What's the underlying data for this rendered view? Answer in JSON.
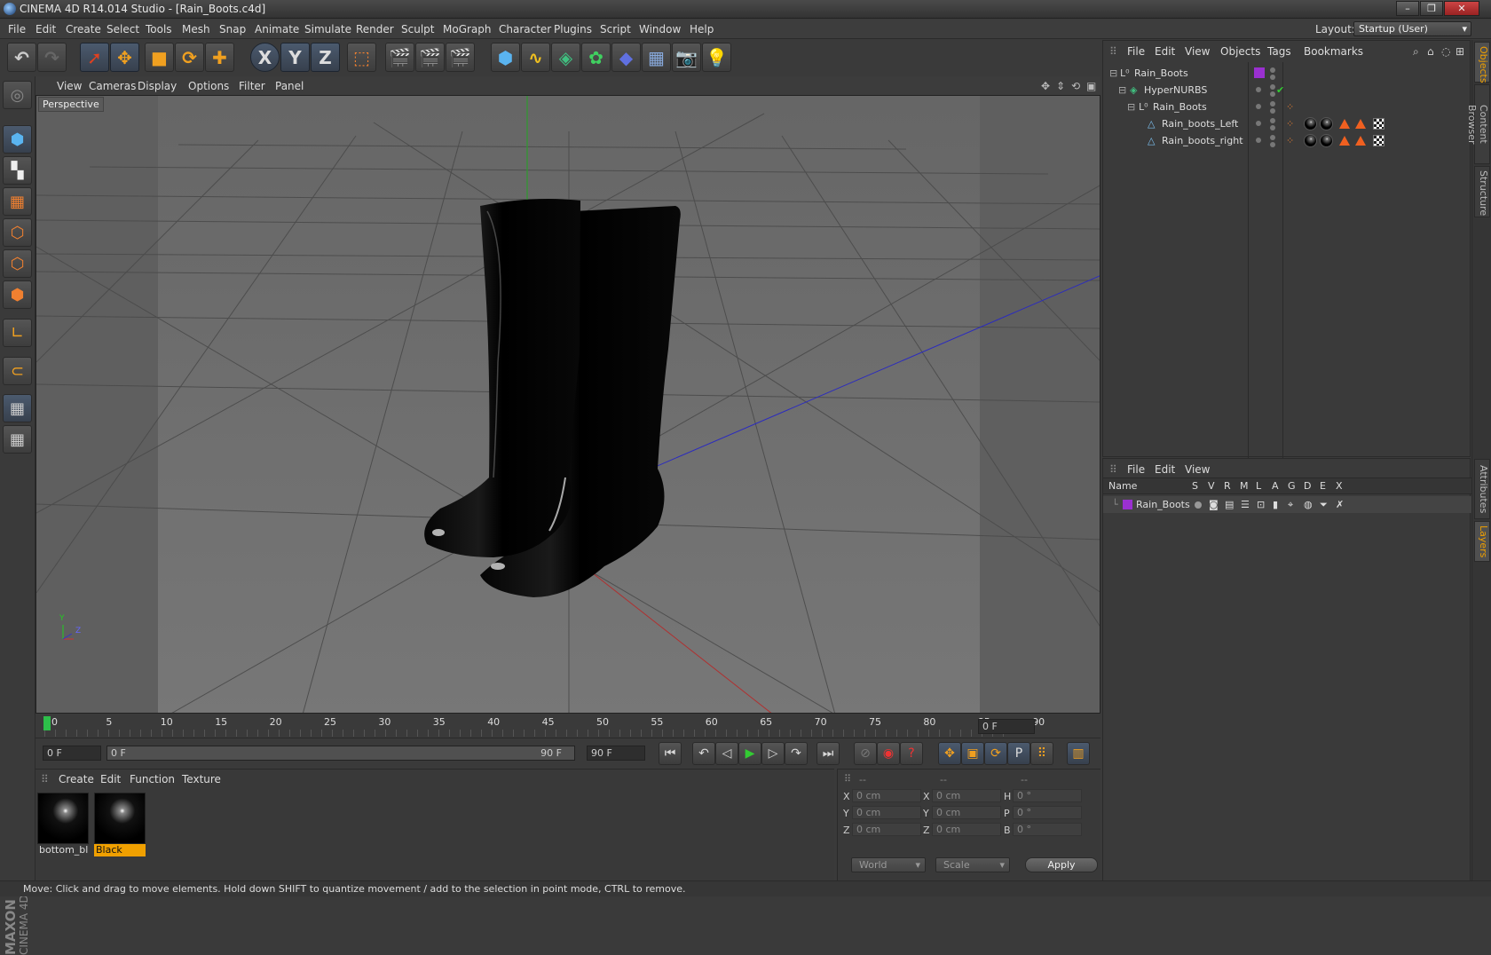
{
  "window": {
    "title": "CINEMA 4D R14.014 Studio - [Rain_Boots.c4d]"
  },
  "menu": [
    "File",
    "Edit",
    "Create",
    "Select",
    "Tools",
    "Mesh",
    "Snap",
    "Animate",
    "Simulate",
    "Render",
    "Sculpt",
    "MoGraph",
    "Character",
    "Plugins",
    "Script",
    "Window",
    "Help"
  ],
  "layout": {
    "label": "Layout:",
    "value": "Startup (User)"
  },
  "toolbar": {
    "x": "X",
    "y": "Y",
    "z": "Z",
    "p": "P"
  },
  "viewport": {
    "menu": [
      "View",
      "Cameras",
      "Display",
      "Options",
      "Filter",
      "Panel"
    ],
    "camera": "Perspective"
  },
  "timeline": {
    "ticks": [
      "0",
      "5",
      "10",
      "15",
      "20",
      "25",
      "30",
      "35",
      "40",
      "45",
      "50",
      "55",
      "60",
      "65",
      "70",
      "75",
      "80",
      "85",
      "90"
    ],
    "current": "0 F",
    "start": "0 F",
    "range_start": "0 F",
    "range_end": "90 F",
    "end": "90 F"
  },
  "materials": {
    "menu": [
      "Create",
      "Edit",
      "Function",
      "Texture"
    ],
    "items": [
      {
        "name": "bottom_bla"
      },
      {
        "name": "Black"
      }
    ]
  },
  "coords": {
    "header": [
      "--",
      "--",
      "--"
    ],
    "rows": [
      {
        "a": "X",
        "av": "0 cm",
        "b": "X",
        "bv": "0 cm",
        "c": "H",
        "cv": "0 °"
      },
      {
        "a": "Y",
        "av": "0 cm",
        "b": "Y",
        "bv": "0 cm",
        "c": "P",
        "cv": "0 °"
      },
      {
        "a": "Z",
        "av": "0 cm",
        "b": "Z",
        "bv": "0 cm",
        "c": "B",
        "cv": "0 °"
      }
    ],
    "world": "World",
    "scale": "Scale",
    "apply": "Apply"
  },
  "objects": {
    "menu": [
      "File",
      "Edit",
      "View",
      "Objects",
      "Tags",
      "Bookmarks"
    ],
    "tree": [
      {
        "name": "Rain_Boots"
      },
      {
        "name": "HyperNURBS"
      },
      {
        "name": "Rain_Boots"
      },
      {
        "name": "Rain_boots_Left"
      },
      {
        "name": "Rain_boots_right"
      }
    ]
  },
  "layers": {
    "menu": [
      "File",
      "Edit",
      "View"
    ],
    "columns": [
      "Name",
      "S",
      "V",
      "R",
      "M",
      "L",
      "A",
      "G",
      "D",
      "E",
      "X"
    ],
    "rows": [
      {
        "name": "Rain_Boots",
        "color": "#9a30d0"
      }
    ]
  },
  "sidetabs": [
    "Objects",
    "Content Browser",
    "Structure",
    "Attributes",
    "Layers"
  ],
  "status": "Move: Click and drag to move elements. Hold down SHIFT to quantize movement / add to the selection in point mode, CTRL to remove.",
  "brand": {
    "maxon": "MAXON",
    "cinema": "CINEMA 4D"
  },
  "axes": {
    "y": "Y",
    "z": "Z"
  }
}
